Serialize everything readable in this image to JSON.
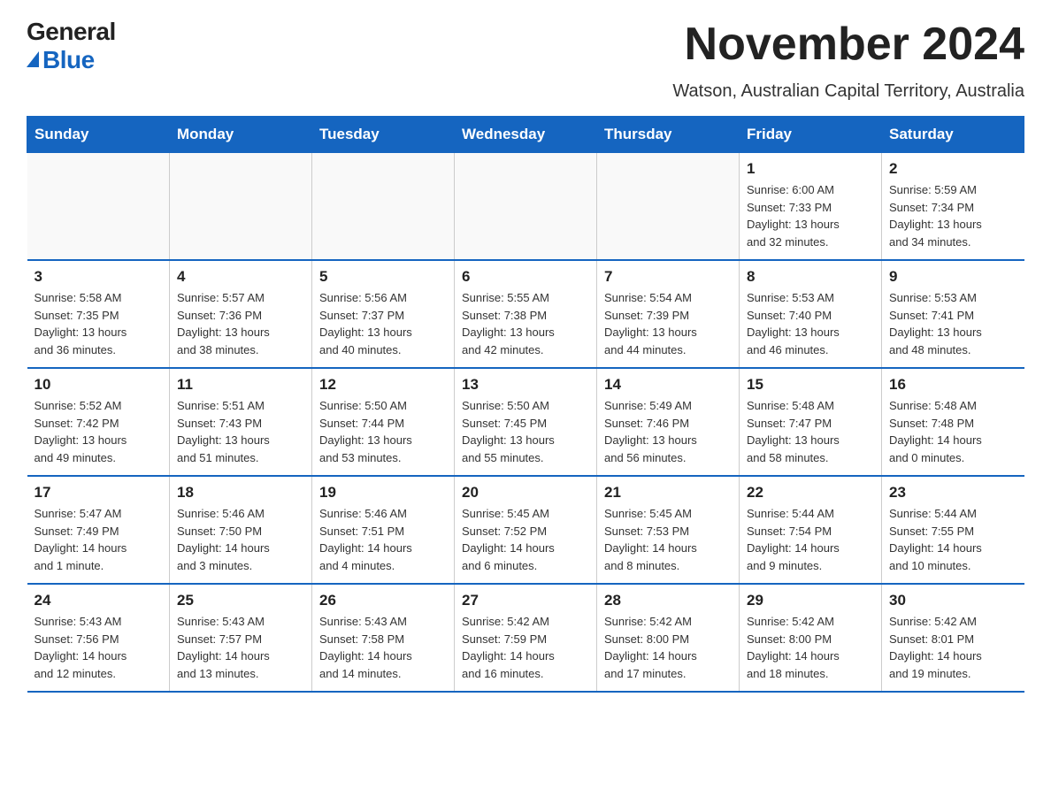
{
  "logo": {
    "general": "General",
    "blue": "Blue"
  },
  "title": "November 2024",
  "subtitle": "Watson, Australian Capital Territory, Australia",
  "weekdays": [
    "Sunday",
    "Monday",
    "Tuesday",
    "Wednesday",
    "Thursday",
    "Friday",
    "Saturday"
  ],
  "weeks": [
    [
      {
        "day": "",
        "info": ""
      },
      {
        "day": "",
        "info": ""
      },
      {
        "day": "",
        "info": ""
      },
      {
        "day": "",
        "info": ""
      },
      {
        "day": "",
        "info": ""
      },
      {
        "day": "1",
        "info": "Sunrise: 6:00 AM\nSunset: 7:33 PM\nDaylight: 13 hours\nand 32 minutes."
      },
      {
        "day": "2",
        "info": "Sunrise: 5:59 AM\nSunset: 7:34 PM\nDaylight: 13 hours\nand 34 minutes."
      }
    ],
    [
      {
        "day": "3",
        "info": "Sunrise: 5:58 AM\nSunset: 7:35 PM\nDaylight: 13 hours\nand 36 minutes."
      },
      {
        "day": "4",
        "info": "Sunrise: 5:57 AM\nSunset: 7:36 PM\nDaylight: 13 hours\nand 38 minutes."
      },
      {
        "day": "5",
        "info": "Sunrise: 5:56 AM\nSunset: 7:37 PM\nDaylight: 13 hours\nand 40 minutes."
      },
      {
        "day": "6",
        "info": "Sunrise: 5:55 AM\nSunset: 7:38 PM\nDaylight: 13 hours\nand 42 minutes."
      },
      {
        "day": "7",
        "info": "Sunrise: 5:54 AM\nSunset: 7:39 PM\nDaylight: 13 hours\nand 44 minutes."
      },
      {
        "day": "8",
        "info": "Sunrise: 5:53 AM\nSunset: 7:40 PM\nDaylight: 13 hours\nand 46 minutes."
      },
      {
        "day": "9",
        "info": "Sunrise: 5:53 AM\nSunset: 7:41 PM\nDaylight: 13 hours\nand 48 minutes."
      }
    ],
    [
      {
        "day": "10",
        "info": "Sunrise: 5:52 AM\nSunset: 7:42 PM\nDaylight: 13 hours\nand 49 minutes."
      },
      {
        "day": "11",
        "info": "Sunrise: 5:51 AM\nSunset: 7:43 PM\nDaylight: 13 hours\nand 51 minutes."
      },
      {
        "day": "12",
        "info": "Sunrise: 5:50 AM\nSunset: 7:44 PM\nDaylight: 13 hours\nand 53 minutes."
      },
      {
        "day": "13",
        "info": "Sunrise: 5:50 AM\nSunset: 7:45 PM\nDaylight: 13 hours\nand 55 minutes."
      },
      {
        "day": "14",
        "info": "Sunrise: 5:49 AM\nSunset: 7:46 PM\nDaylight: 13 hours\nand 56 minutes."
      },
      {
        "day": "15",
        "info": "Sunrise: 5:48 AM\nSunset: 7:47 PM\nDaylight: 13 hours\nand 58 minutes."
      },
      {
        "day": "16",
        "info": "Sunrise: 5:48 AM\nSunset: 7:48 PM\nDaylight: 14 hours\nand 0 minutes."
      }
    ],
    [
      {
        "day": "17",
        "info": "Sunrise: 5:47 AM\nSunset: 7:49 PM\nDaylight: 14 hours\nand 1 minute."
      },
      {
        "day": "18",
        "info": "Sunrise: 5:46 AM\nSunset: 7:50 PM\nDaylight: 14 hours\nand 3 minutes."
      },
      {
        "day": "19",
        "info": "Sunrise: 5:46 AM\nSunset: 7:51 PM\nDaylight: 14 hours\nand 4 minutes."
      },
      {
        "day": "20",
        "info": "Sunrise: 5:45 AM\nSunset: 7:52 PM\nDaylight: 14 hours\nand 6 minutes."
      },
      {
        "day": "21",
        "info": "Sunrise: 5:45 AM\nSunset: 7:53 PM\nDaylight: 14 hours\nand 8 minutes."
      },
      {
        "day": "22",
        "info": "Sunrise: 5:44 AM\nSunset: 7:54 PM\nDaylight: 14 hours\nand 9 minutes."
      },
      {
        "day": "23",
        "info": "Sunrise: 5:44 AM\nSunset: 7:55 PM\nDaylight: 14 hours\nand 10 minutes."
      }
    ],
    [
      {
        "day": "24",
        "info": "Sunrise: 5:43 AM\nSunset: 7:56 PM\nDaylight: 14 hours\nand 12 minutes."
      },
      {
        "day": "25",
        "info": "Sunrise: 5:43 AM\nSunset: 7:57 PM\nDaylight: 14 hours\nand 13 minutes."
      },
      {
        "day": "26",
        "info": "Sunrise: 5:43 AM\nSunset: 7:58 PM\nDaylight: 14 hours\nand 14 minutes."
      },
      {
        "day": "27",
        "info": "Sunrise: 5:42 AM\nSunset: 7:59 PM\nDaylight: 14 hours\nand 16 minutes."
      },
      {
        "day": "28",
        "info": "Sunrise: 5:42 AM\nSunset: 8:00 PM\nDaylight: 14 hours\nand 17 minutes."
      },
      {
        "day": "29",
        "info": "Sunrise: 5:42 AM\nSunset: 8:00 PM\nDaylight: 14 hours\nand 18 minutes."
      },
      {
        "day": "30",
        "info": "Sunrise: 5:42 AM\nSunset: 8:01 PM\nDaylight: 14 hours\nand 19 minutes."
      }
    ]
  ]
}
